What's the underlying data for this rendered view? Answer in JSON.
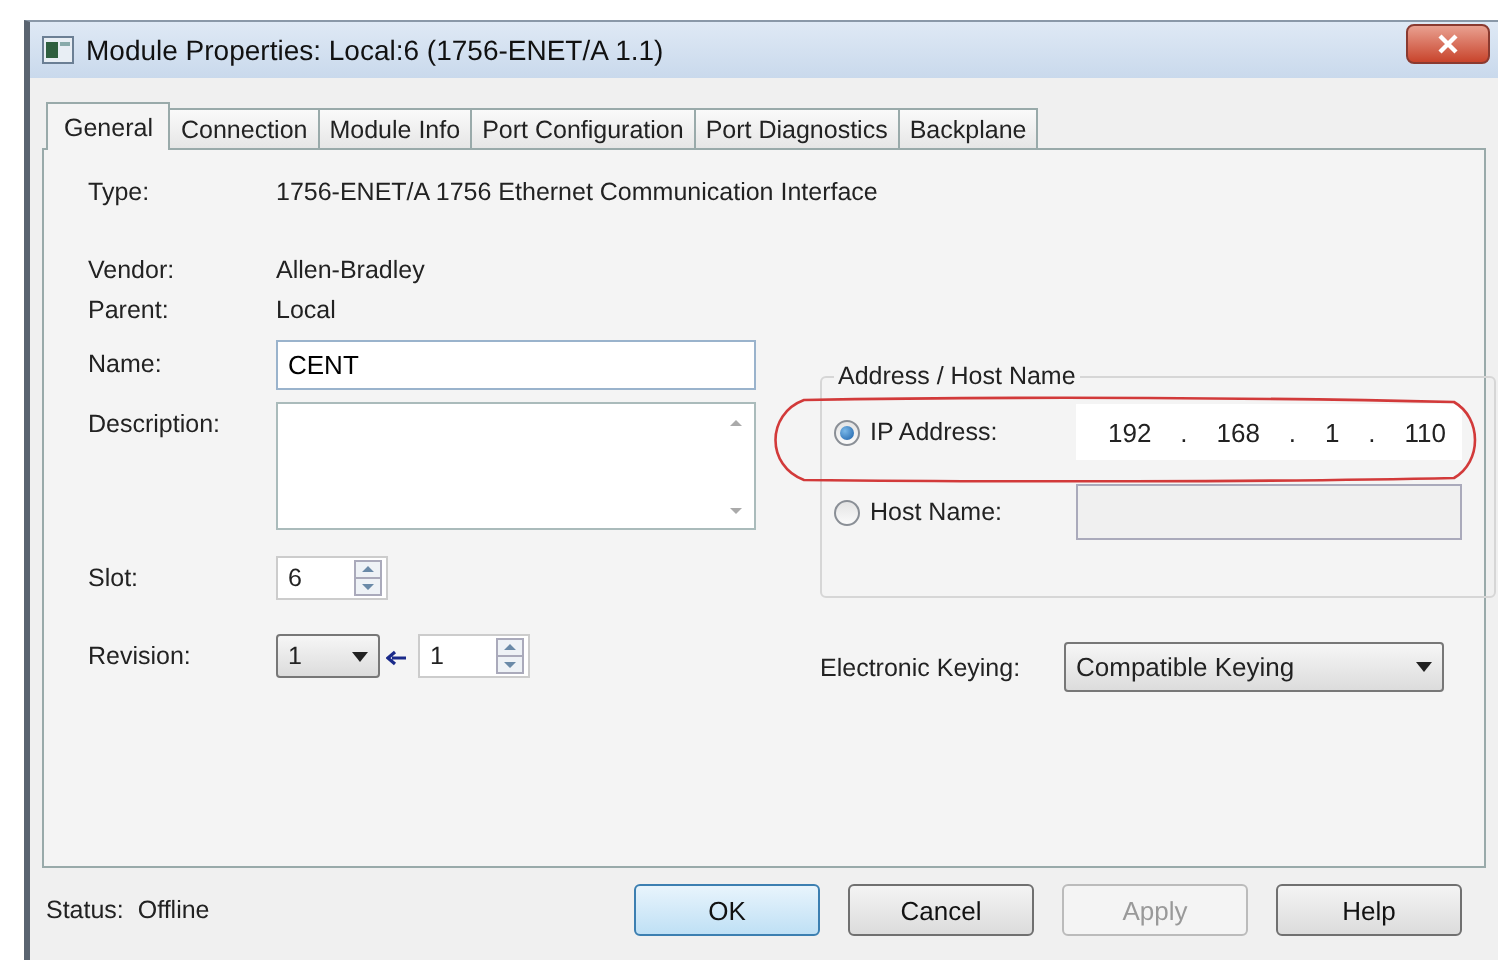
{
  "window": {
    "title": "Module Properties: Local:6 (1756-ENET/A 1.1)"
  },
  "tabs": [
    {
      "label": "General",
      "selected": true
    },
    {
      "label": "Connection",
      "selected": false
    },
    {
      "label": "Module Info",
      "selected": false
    },
    {
      "label": "Port Configuration",
      "selected": false
    },
    {
      "label": "Port Diagnostics",
      "selected": false
    },
    {
      "label": "Backplane",
      "selected": false
    }
  ],
  "general": {
    "type": {
      "label": "Type:",
      "value": "1756-ENET/A 1756 Ethernet Communication Interface"
    },
    "vendor": {
      "label": "Vendor:",
      "value": "Allen-Bradley"
    },
    "parent": {
      "label": "Parent:",
      "value": "Local"
    },
    "name": {
      "label": "Name:",
      "value": "CENT"
    },
    "description": {
      "label": "Description:"
    },
    "slot": {
      "label": "Slot:",
      "value": "6"
    },
    "revision": {
      "label": "Revision:",
      "major": "1",
      "minor": "1"
    }
  },
  "address_group": {
    "legend": "Address / Host Name",
    "options": [
      {
        "kind": "ip",
        "label": "IP Address:",
        "selected": true,
        "octets": [
          "192",
          "168",
          "1",
          "110"
        ],
        "separator": ".",
        "disabled": false
      },
      {
        "kind": "host",
        "label": "Host Name:",
        "selected": false,
        "disabled": true
      }
    ]
  },
  "electronic_keying": {
    "label": "Electronic Keying:",
    "value": "Compatible Keying"
  },
  "status": {
    "label": "Status:",
    "value": "Offline"
  },
  "buttons": [
    {
      "label": "OK",
      "default": true,
      "disabled": false
    },
    {
      "label": "Cancel",
      "default": false,
      "disabled": false
    },
    {
      "label": "Apply",
      "default": false,
      "disabled": true
    },
    {
      "label": "Help",
      "default": false,
      "disabled": false
    }
  ]
}
